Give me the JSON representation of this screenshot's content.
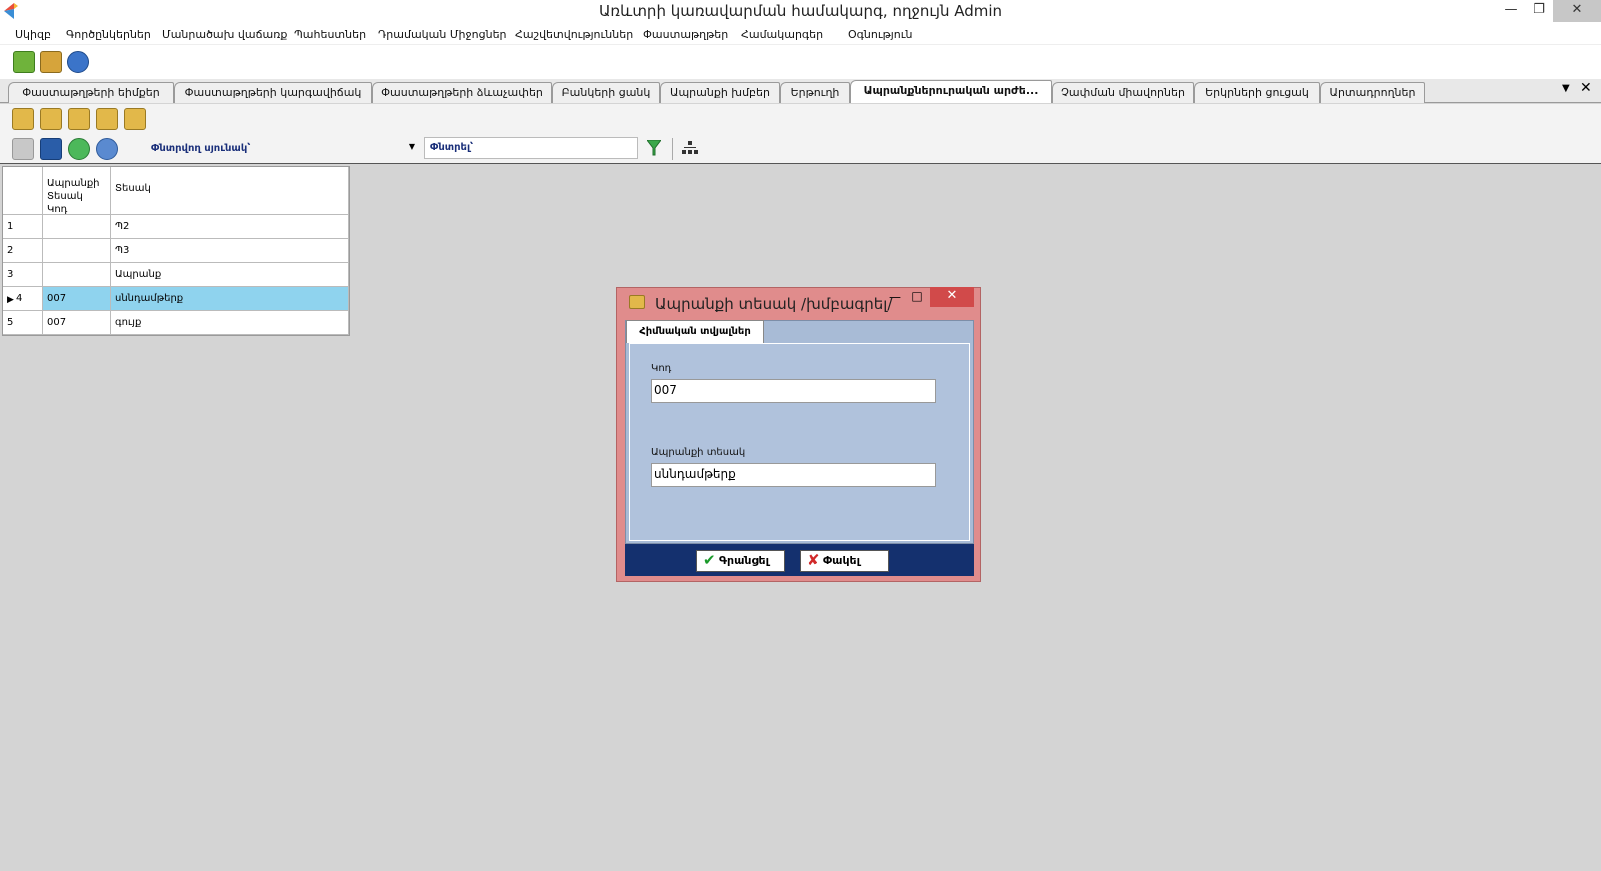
{
  "window": {
    "title": "Առևտրի կառավարման համակարգ, ողջույն Admin"
  },
  "menu": [
    "Սկիզբ",
    "Գործընկերներ",
    "Մանրածախ վաճառք",
    "Պահեստներ",
    "Դրամական Միջոցներ",
    "Հաշվետվություններ",
    "Փաստաթղթեր",
    "Համակարգեր",
    "Օգնություն"
  ],
  "tabs": [
    "Փաստաթղթերի եիմքեր",
    "Փաստաթղթերի կարգավիճակ",
    "Փաստաթղթերի ձևաչափեր",
    "Բանկերի ցանկ",
    "Ապրանքի խմբեր",
    "Երթուղի",
    "Ապրանքներուրական արժե...",
    "Չափման միավորներ",
    "Երկրների ցուցակ",
    "Արտադրողներ"
  ],
  "active_tab_index": 6,
  "filterbar": {
    "search_column_label": "Փնտրվող սյունակ՝",
    "search_label": "Փնտրել՝"
  },
  "grid": {
    "columns": [
      "",
      "Ապրանքի Տեսակ Կոդ",
      "Տեսակ"
    ],
    "rows": [
      {
        "num": "1",
        "code": "",
        "type": "Պ2"
      },
      {
        "num": "2",
        "code": "",
        "type": "Պ3"
      },
      {
        "num": "3",
        "code": "",
        "type": "Ապրանք"
      },
      {
        "num": "4",
        "code": "007",
        "type": "սննդամթերք"
      },
      {
        "num": "5",
        "code": "007",
        "type": "գույք"
      }
    ],
    "selected_row": 3
  },
  "dialog": {
    "title": "Ապրանքի տեսակ /խմբագրել/",
    "tab_label": "Հիմնական տվյալներ",
    "code_label": "Կոդ",
    "code_value": "007",
    "type_label": "Ապրանքի տեսակ",
    "type_value": "սննդամթերք",
    "ok_label": "Գրանցել",
    "close_label": "Փակել"
  },
  "colors": {
    "accent_selected_row": "#8fd3ee",
    "dialog_frame": "#e08c8c",
    "dialog_footer": "#14306e"
  }
}
